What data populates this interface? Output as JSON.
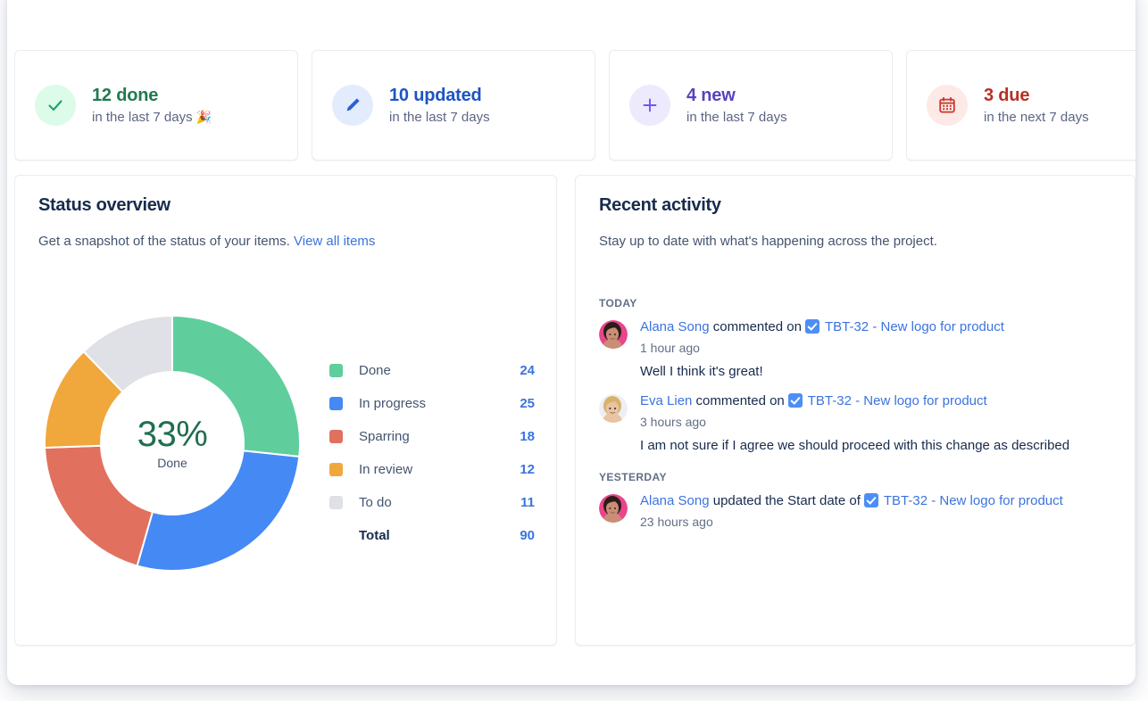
{
  "stats": [
    {
      "count": "12 done",
      "sub": "in the last 7 days",
      "emoji": "🎉",
      "icon": "check-icon",
      "color_class": "c-done",
      "icon_bg": "#dcfbe9",
      "icon_fg": "#22a06b"
    },
    {
      "count": "10 updated",
      "sub": "in the last 7 days",
      "emoji": "",
      "icon": "pencil-icon",
      "color_class": "c-updated",
      "icon_bg": "#e3ecfd",
      "icon_fg": "#2a5fd6"
    },
    {
      "count": "4 new",
      "sub": "in the last 7 days",
      "emoji": "",
      "icon": "plus-icon",
      "color_class": "c-new",
      "icon_bg": "#eeeafd",
      "icon_fg": "#6a5af0"
    },
    {
      "count": "3 due",
      "sub": "in the next 7 days",
      "emoji": "",
      "icon": "calendar-icon",
      "color_class": "c-due",
      "icon_bg": "#fdeae7",
      "icon_fg": "#c9372c"
    }
  ],
  "status_panel": {
    "title": "Status overview",
    "description": "Get a snapshot of the status of your items.",
    "view_all_label": "View all items",
    "center_percent": "33%",
    "center_label": "Done",
    "total_label": "Total",
    "total_value": "90"
  },
  "chart_data": {
    "type": "pie",
    "title": "Status overview",
    "variant": "donut",
    "start_angle_deg": 0,
    "direction": "clockwise",
    "center_percent": 33,
    "center_label": "Done",
    "categories": [
      "Done",
      "In progress",
      "Sparring",
      "In review",
      "To do"
    ],
    "values": [
      24,
      25,
      18,
      12,
      11
    ],
    "colors": [
      "#5fce9c",
      "#4589f5",
      "#e2705e",
      "#f0a73c",
      "#dfe1e6"
    ],
    "total": 90,
    "legend_position": "right",
    "grid": false,
    "xlabel": "",
    "ylabel": ""
  },
  "legend": [
    {
      "label": "Done",
      "value": "24",
      "color": "#5fce9c"
    },
    {
      "label": "In progress",
      "value": "25",
      "color": "#4589f5"
    },
    {
      "label": "Sparring",
      "value": "18",
      "color": "#e2705e"
    },
    {
      "label": "In review",
      "value": "12",
      "color": "#f0a73c"
    },
    {
      "label": "To do",
      "value": "11",
      "color": "#dfe1e6"
    }
  ],
  "activity_panel": {
    "title": "Recent activity",
    "description": "Stay up to date with what's happening across the project.",
    "groups": [
      {
        "day": "TODAY",
        "items": [
          {
            "actor": "Alana Song",
            "action": "commented on",
            "issue": "TBT-32 - New logo for product",
            "time": "1 hour ago",
            "comment": "Well I think it's great!",
            "avatar": "avatar-alana"
          },
          {
            "actor": "Eva Lien",
            "action": "commented on",
            "issue": "TBT-32 - New logo for product",
            "time": "3 hours ago",
            "comment": "I am not sure if I agree we should proceed with this change as described",
            "avatar": "avatar-eva"
          }
        ]
      },
      {
        "day": "YESTERDAY",
        "items": [
          {
            "actor": "Alana Song",
            "action": "updated the Start date of",
            "issue": "TBT-32 - New logo for product",
            "time": "23 hours ago",
            "comment": "",
            "avatar": "avatar-alana"
          }
        ]
      }
    ]
  }
}
